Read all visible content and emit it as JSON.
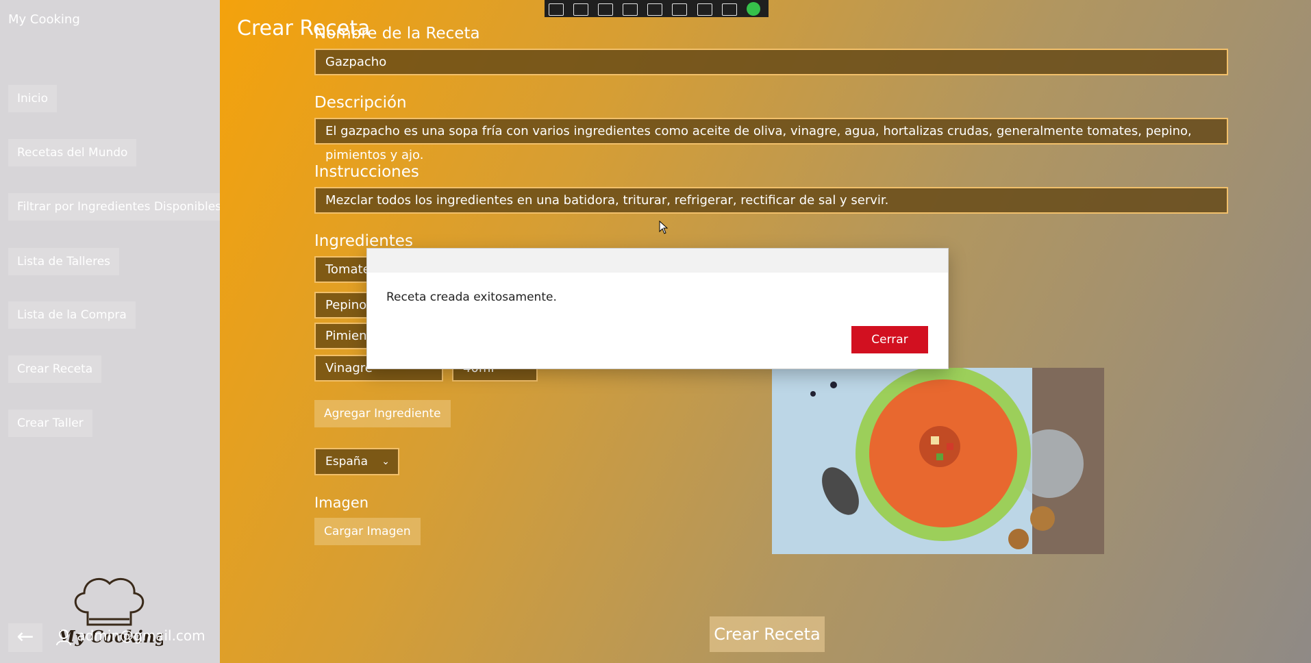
{
  "app": {
    "title": "My Cooking",
    "logo_text": "My Cooking",
    "user_email": "admin@gmail.com"
  },
  "sidebar": {
    "items": [
      {
        "label": "Inicio"
      },
      {
        "label": "Recetas del Mundo"
      },
      {
        "label": "Filtrar por Ingredientes Disponibles"
      },
      {
        "label": "Lista de Talleres"
      },
      {
        "label": "Lista de la Compra"
      },
      {
        "label": "Crear Receta"
      },
      {
        "label": "Crear Taller"
      }
    ],
    "back_icon": "arrow-left-icon",
    "user_icon": "user-icon"
  },
  "page": {
    "title": "Crear Receta",
    "name_label": "Nombre de la Receta",
    "name_value": "Gazpacho",
    "description_label": "Descripción",
    "description_value": "El gazpacho es una sopa fría con varios ingredientes como aceite de oliva, vinagre, agua, hortalizas crudas, generalmente tomates, pepino, pimientos y ajo.",
    "instructions_label": "Instrucciones",
    "instructions_value": "Mezclar todos los ingredientes en una batidora, triturar, refrigerar, rectificar de sal y servir.",
    "ingredients_label": "Ingredientes",
    "ingredients": [
      {
        "name": "Tomate",
        "qty": ""
      },
      {
        "name": "Pepino",
        "qty": ""
      },
      {
        "name": "Pimient",
        "qty": ""
      },
      {
        "name": "Vinagre",
        "qty": "40ml"
      }
    ],
    "add_ingredient_label": "Agregar Ingrediente",
    "country_value": "España",
    "image_label": "Imagen",
    "load_image_label": "Cargar Imagen",
    "create_button_label": "Crear Receta"
  },
  "dialog": {
    "message": "Receta creada exitosamente.",
    "close_label": "Cerrar"
  },
  "colors": {
    "accent_red": "#d21020",
    "field_border": "#f2c06b"
  }
}
